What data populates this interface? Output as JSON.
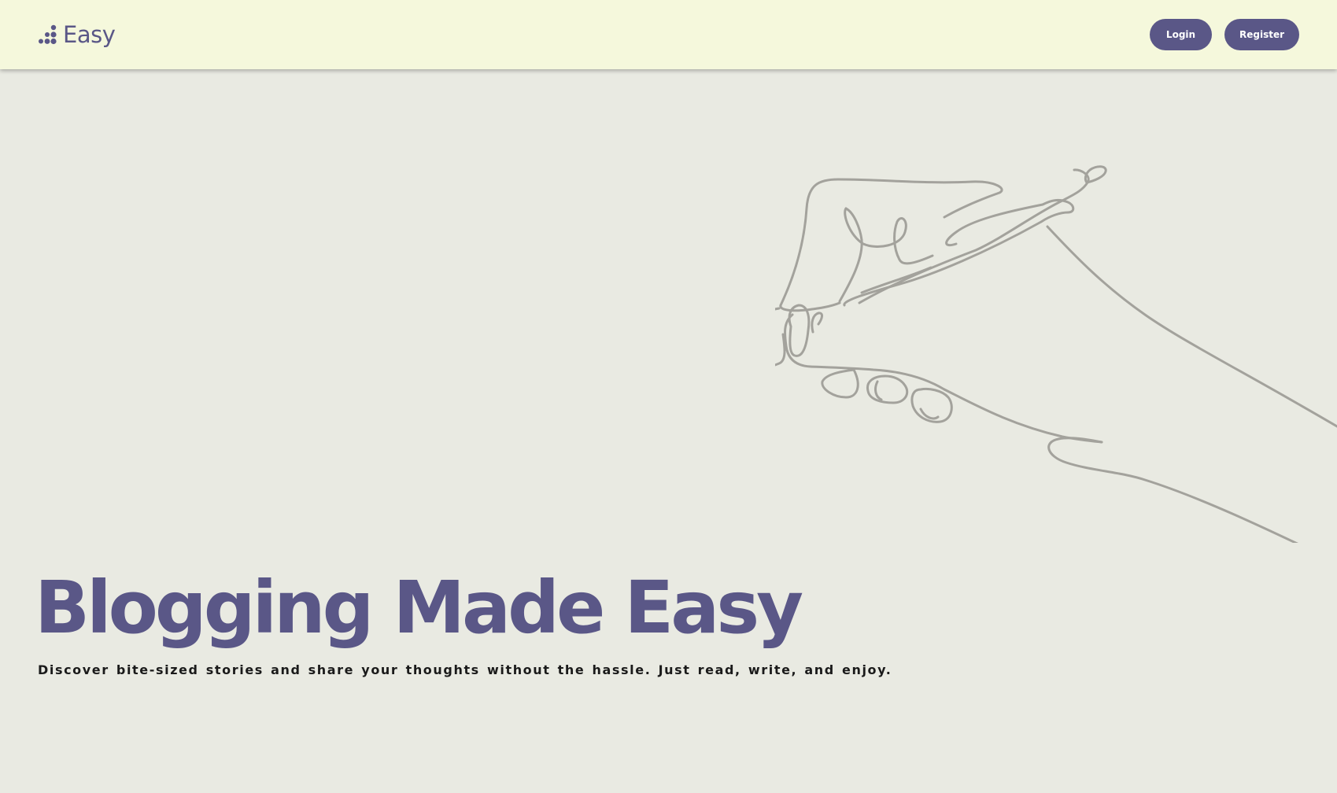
{
  "navbar": {
    "brand": {
      "icon": "dots-logo-icon",
      "name": "Easy"
    },
    "login_label": "Login",
    "register_label": "Register"
  },
  "hero": {
    "title": "Blogging Made Easy",
    "subtitle": "Discover bite-sized stories and share your thoughts without the hassle. Just read, write, and enjoy.",
    "illustration": "hand-writing-line-art"
  },
  "colors": {
    "accent": "#5a5787",
    "navbar_bg": "#f5f8dc",
    "page_bg": "#e9eae2",
    "illustration_stroke": "#a3a29c"
  }
}
